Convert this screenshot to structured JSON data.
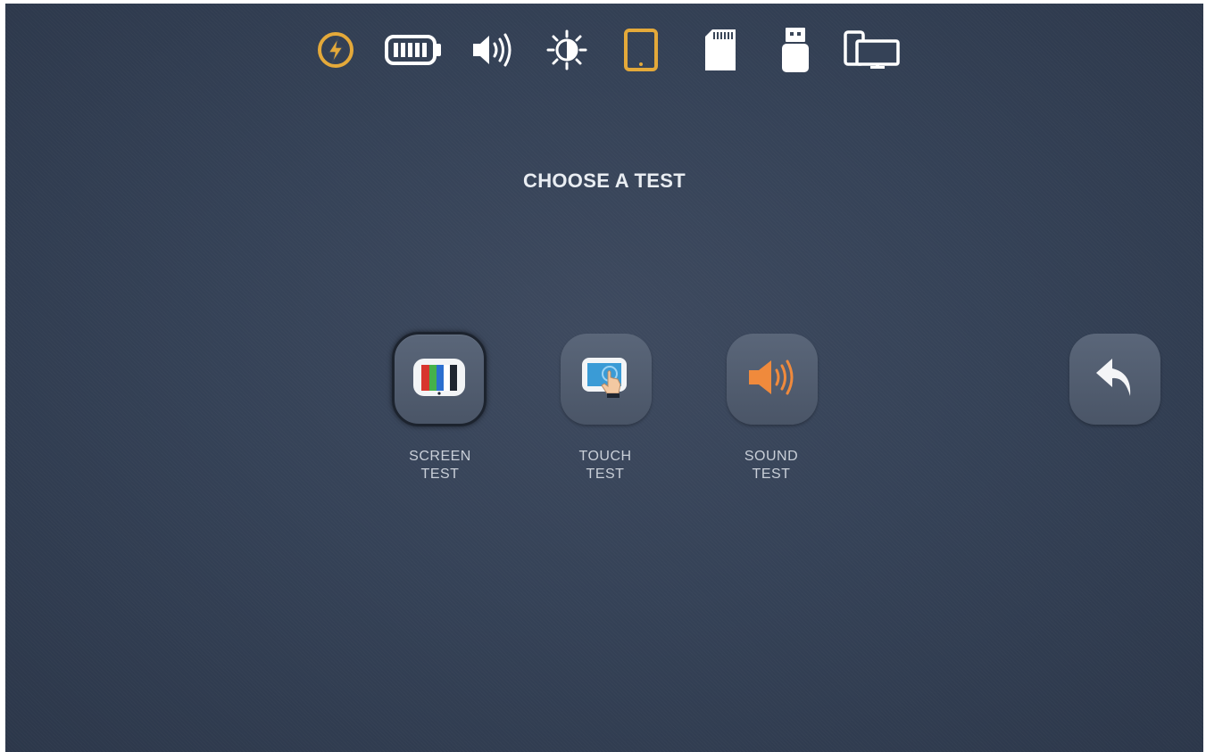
{
  "status_bar": {
    "icons": [
      {
        "name": "power-icon",
        "color": "#e4a93a"
      },
      {
        "name": "battery-icon",
        "color": "#ffffff"
      },
      {
        "name": "volume-icon",
        "color": "#ffffff"
      },
      {
        "name": "brightness-icon",
        "color": "#ffffff"
      },
      {
        "name": "tablet-icon",
        "color": "#e4a93a"
      },
      {
        "name": "sd-card-icon",
        "color": "#ffffff"
      },
      {
        "name": "usb-drive-icon",
        "color": "#ffffff"
      },
      {
        "name": "display-mirror-icon",
        "color": "#ffffff"
      }
    ]
  },
  "page": {
    "title": "CHOOSE A TEST"
  },
  "tests": [
    {
      "id": "screen",
      "label_line1": "SCREEN",
      "label_line2": "TEST",
      "icon": "tv-color-bars-icon",
      "selected": true
    },
    {
      "id": "touch",
      "label_line1": "TOUCH",
      "label_line2": "TEST",
      "icon": "touch-screen-icon",
      "selected": false
    },
    {
      "id": "sound",
      "label_line1": "SOUND",
      "label_line2": "TEST",
      "icon": "speaker-icon",
      "selected": false
    }
  ],
  "navigation": {
    "back_icon": "back-arrow-icon"
  },
  "colors": {
    "accent": "#e4a93a",
    "speaker": "#f08a3c",
    "background": "#354257",
    "tile": "#525e71"
  }
}
